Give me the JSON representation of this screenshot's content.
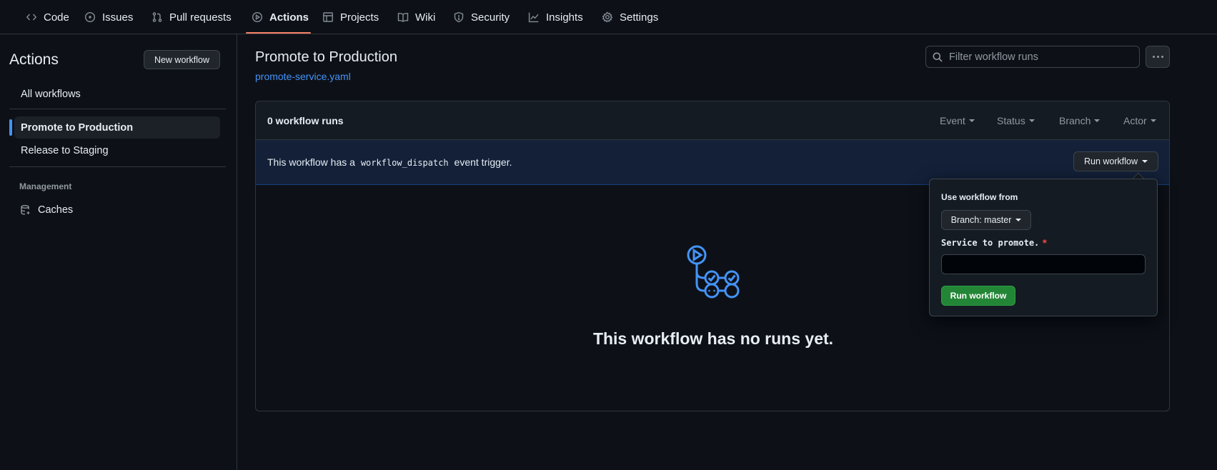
{
  "nav": {
    "tabs": [
      {
        "label": "Code",
        "icon": "code-icon"
      },
      {
        "label": "Issues",
        "icon": "issue-icon"
      },
      {
        "label": "Pull requests",
        "icon": "pull-request-icon"
      },
      {
        "label": "Actions",
        "icon": "play-icon",
        "active": true
      },
      {
        "label": "Projects",
        "icon": "table-icon"
      },
      {
        "label": "Wiki",
        "icon": "book-icon"
      },
      {
        "label": "Security",
        "icon": "shield-icon"
      },
      {
        "label": "Insights",
        "icon": "graph-icon"
      },
      {
        "label": "Settings",
        "icon": "gear-icon"
      }
    ],
    "active_underline_color": "#f78166"
  },
  "sidebar": {
    "title": "Actions",
    "new_workflow_label": "New workflow",
    "all_workflows_label": "All workflows",
    "workflows": [
      {
        "label": "Promote to Production",
        "selected": true
      },
      {
        "label": "Release to Staging",
        "selected": false
      }
    ],
    "management_heading": "Management",
    "caches_label": "Caches"
  },
  "main": {
    "workflow_title": "Promote to Production",
    "workflow_file": "promote-service.yaml",
    "filter_placeholder": "Filter workflow runs",
    "runs_count_label": "0 workflow runs",
    "facets": {
      "event": "Event",
      "status": "Status",
      "branch": "Branch",
      "actor": "Actor"
    },
    "banner": {
      "prefix": "This workflow has a",
      "code": "workflow_dispatch",
      "suffix": "event trigger.",
      "run_workflow_label": "Run workflow"
    },
    "empty_message": "This workflow has no runs yet."
  },
  "popover": {
    "use_workflow_from_label": "Use workflow from",
    "branch_select_label": "Branch: master",
    "input_label": "Service to promote.",
    "required_mark": "*",
    "input_value": "",
    "submit_label": "Run workflow"
  },
  "colors": {
    "accent_blue": "#4493f8",
    "primary_green": "#238636",
    "required_red": "#f85149",
    "background": "#0d1117"
  }
}
